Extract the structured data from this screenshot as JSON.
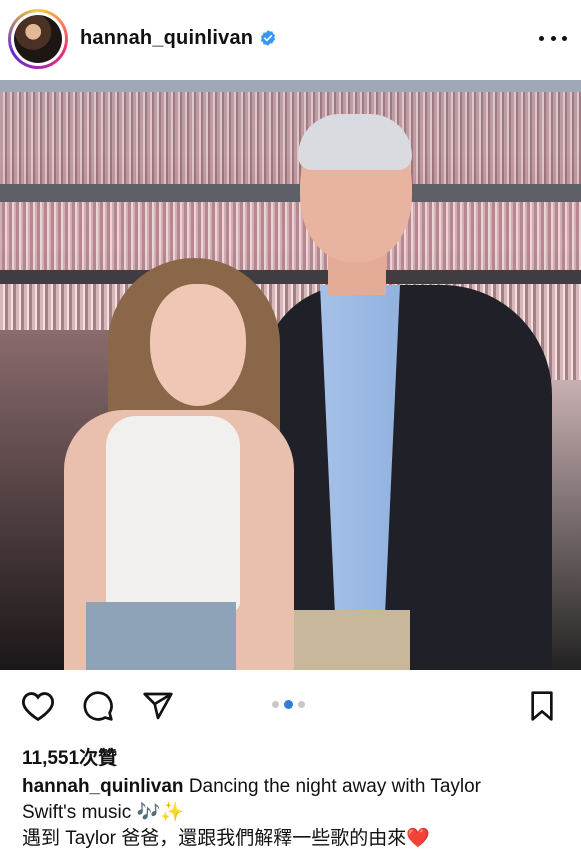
{
  "header": {
    "username": "hannah_quinlivan",
    "verified": true,
    "accent_color": "#3897f0"
  },
  "post": {
    "image_description_icon": "photo",
    "carousel": {
      "total": 3,
      "active_index": 1
    }
  },
  "actions": {
    "like_icon": "heart-icon",
    "comment_icon": "comment-icon",
    "share_icon": "send-icon",
    "save_icon": "bookmark-icon"
  },
  "stats": {
    "likes": "11,551次贊"
  },
  "caption": {
    "username": "hannah_quinlivan",
    "line1": "Dancing the night away with Taylor",
    "line2": "Swift's music 🎶✨",
    "line3": "遇到 Taylor 爸爸，還跟我們解釋一些歌的由來",
    "line3_emoji": "❤️"
  }
}
